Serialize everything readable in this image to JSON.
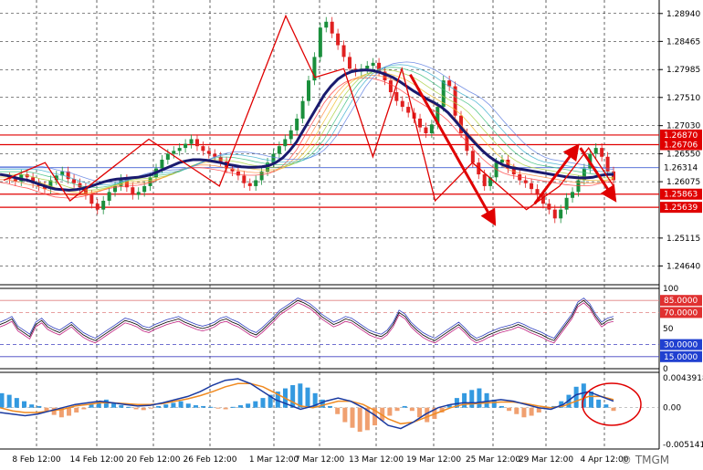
{
  "chart_data": {
    "type": "line",
    "symbol_hint": "",
    "main_panel": {
      "price_ticks": [
        "1.28940",
        "1.28465",
        "1.27985",
        "1.27510",
        "1.27030",
        "1.26550",
        "1.26075",
        "1.25115",
        "1.24640"
      ],
      "price_range": [
        1.2432,
        1.2917
      ],
      "levels": [
        {
          "label": "1.26870",
          "value": 1.2687,
          "color": "#e00000"
        },
        {
          "label": "1.26706",
          "value": 1.26706,
          "color": "#e00000"
        },
        {
          "label": "1.26314",
          "value": 1.26314,
          "color": "#2244cc"
        },
        {
          "label": "1.25863",
          "value": 1.25863,
          "color": "#e00000"
        },
        {
          "label": "1.25639",
          "value": 1.25639,
          "color": "#e00000"
        }
      ],
      "price_series": [
        1.2615,
        1.2612,
        1.2608,
        1.262,
        1.2615,
        1.2605,
        1.26,
        1.2595,
        1.261,
        1.2618,
        1.2625,
        1.2612,
        1.2605,
        1.2598,
        1.2585,
        1.257,
        1.256,
        1.2575,
        1.259,
        1.26,
        1.2612,
        1.2598,
        1.2585,
        1.259,
        1.26,
        1.2615,
        1.263,
        1.2645,
        1.2655,
        1.266,
        1.2665,
        1.2672,
        1.268,
        1.2668,
        1.266,
        1.2655,
        1.265,
        1.2642,
        1.263,
        1.2625,
        1.2618,
        1.2605,
        1.26,
        1.261,
        1.2625,
        1.264,
        1.2655,
        1.2668,
        1.268,
        1.2695,
        1.2715,
        1.2745,
        1.278,
        1.282,
        1.287,
        1.288,
        1.286,
        1.284,
        1.282,
        1.28,
        1.2795,
        1.28,
        1.2805,
        1.281,
        1.2795,
        1.278,
        1.276,
        1.2745,
        1.2735,
        1.2725,
        1.2715,
        1.27,
        1.269,
        1.2705,
        1.2735,
        1.278,
        1.277,
        1.272,
        1.269,
        1.266,
        1.264,
        1.262,
        1.26,
        1.2615,
        1.264,
        1.2645,
        1.263,
        1.262,
        1.261,
        1.2605,
        1.2595,
        1.2585,
        1.257,
        1.256,
        1.2545,
        1.256,
        1.258,
        1.259,
        1.261,
        1.263,
        1.2655,
        1.2665,
        1.265,
        1.2625,
        1.261
      ],
      "ma_series": [
        1.262,
        1.2618,
        1.2615,
        1.2612,
        1.261,
        1.2606,
        1.2602,
        1.2598,
        1.2595,
        1.2594,
        1.2593,
        1.2594,
        1.2596,
        1.2599,
        1.2603,
        1.2607,
        1.261,
        1.2612,
        1.2613,
        1.2614,
        1.2615,
        1.2617,
        1.262,
        1.2625,
        1.263,
        1.2635,
        1.264,
        1.2643,
        1.2645,
        1.2645,
        1.2644,
        1.2642,
        1.264,
        1.2637,
        1.2635,
        1.2633,
        1.2632,
        1.2632,
        1.2633,
        1.2635,
        1.264,
        1.2648,
        1.266,
        1.2675,
        1.2695,
        1.2715,
        1.2735,
        1.2755,
        1.277,
        1.2782,
        1.279,
        1.2795,
        1.2797,
        1.2798,
        1.2797,
        1.2794,
        1.279,
        1.2785,
        1.2778,
        1.277,
        1.2762,
        1.2755,
        1.2748,
        1.2742,
        1.2735,
        1.2725,
        1.2712,
        1.2698,
        1.2685,
        1.2672,
        1.266,
        1.265,
        1.2642,
        1.2636,
        1.2632,
        1.263,
        1.2628,
        1.2626,
        1.2624,
        1.2622,
        1.262,
        1.2618,
        1.2616,
        1.2615,
        1.2614,
        1.2614,
        1.2615,
        1.2618,
        1.262,
        1.262
      ],
      "zigzag": [
        [
          0,
          1.261
        ],
        [
          10,
          1.264
        ],
        [
          16,
          1.2575
        ],
        [
          35,
          1.268
        ],
        [
          52,
          1.26
        ],
        [
          68,
          1.289
        ],
        [
          75,
          1.2785
        ],
        [
          82,
          1.28
        ],
        [
          89,
          1.265
        ],
        [
          96,
          1.28
        ],
        [
          104,
          1.2575
        ],
        [
          113,
          1.264
        ],
        [
          126,
          1.256
        ],
        [
          134,
          1.26
        ],
        [
          141,
          1.2665
        ],
        [
          147,
          1.26
        ]
      ],
      "arrows": [
        {
          "from": [
            98,
            1.279
          ],
          "to": [
            118,
            1.254
          ]
        },
        {
          "from": [
            128,
            1.257
          ],
          "to": [
            138,
            1.2665
          ]
        },
        {
          "from": [
            139,
            1.2665
          ],
          "to": [
            147,
            1.258
          ]
        }
      ]
    },
    "rsi_panel": {
      "ticks": [
        "100",
        "85.0000",
        "70.0000",
        "50",
        "30.0000",
        "15.0000",
        "0"
      ],
      "levels": [
        85,
        70,
        30,
        15
      ],
      "level_labels": [
        "85.0000",
        "70.0000",
        "30.0000",
        "15.0000"
      ],
      "series": [
        55,
        58,
        62,
        50,
        45,
        40,
        55,
        60,
        52,
        48,
        45,
        50,
        55,
        48,
        42,
        38,
        35,
        40,
        45,
        50,
        55,
        60,
        58,
        55,
        50,
        48,
        52,
        55,
        58,
        60,
        62,
        58,
        55,
        52,
        50,
        52,
        55,
        60,
        62,
        58,
        55,
        50,
        45,
        42,
        48,
        55,
        62,
        70,
        75,
        80,
        85,
        82,
        78,
        72,
        65,
        60,
        55,
        58,
        62,
        60,
        55,
        50,
        45,
        42,
        40,
        45,
        55,
        70,
        65,
        55,
        48,
        42,
        38,
        35,
        40,
        45,
        50,
        55,
        48,
        40,
        35,
        38,
        42,
        45,
        48,
        50,
        52,
        55,
        52,
        48,
        45,
        42,
        38,
        35,
        45,
        55,
        65,
        80,
        85,
        78,
        65,
        55,
        60,
        62
      ]
    },
    "macd_panel": {
      "ticks": [
        "0.0043918",
        "0.00",
        "-0.0051412"
      ],
      "range": [
        -0.0051412,
        0.0043918
      ],
      "histogram": [
        0.0018,
        0.0016,
        0.0012,
        0.0008,
        0.0004,
        0.0002,
        -0.0004,
        -0.0009,
        -0.0012,
        -0.001,
        -0.0006,
        -0.0002,
        0.0004,
        0.0008,
        0.001,
        0.0006,
        0.0003,
        0.0001,
        -0.0002,
        -0.0003,
        -0.0001,
        0.0002,
        0.0004,
        0.0006,
        0.0008,
        0.0005,
        0.0003,
        0.0002,
        0.0001,
        -0.0001,
        -0.0002,
        0.0001,
        0.0003,
        0.0005,
        0.0008,
        0.0012,
        0.0016,
        0.002,
        0.0024,
        0.0028,
        0.003,
        0.0025,
        0.0018,
        0.001,
        0.0002,
        -0.0008,
        -0.0018,
        -0.0025,
        -0.003,
        -0.0028,
        -0.0022,
        -0.0016,
        -0.001,
        -0.0004,
        0.0002,
        -0.0004,
        -0.0012,
        -0.0018,
        -0.0014,
        -0.0006,
        0.0004,
        0.0012,
        0.0018,
        0.0022,
        0.0024,
        0.0018,
        0.001,
        0.0002,
        -0.0004,
        -0.0008,
        -0.0012,
        -0.001,
        -0.0006,
        -0.0002,
        0.0002,
        0.0008,
        0.0016,
        0.0026,
        0.003,
        0.002,
        0.001,
        0.0004,
        -0.0004
      ],
      "macd_line": [
        -0.0006,
        -0.0008,
        -0.001,
        -0.0008,
        -0.0004,
        0.0,
        0.0004,
        0.0006,
        0.0008,
        0.0006,
        0.0004,
        0.0002,
        0.0003,
        0.0006,
        0.001,
        0.0014,
        0.002,
        0.0028,
        0.0034,
        0.0036,
        0.003,
        0.002,
        0.001,
        0.0004,
        -0.0002,
        0.0002,
        0.0008,
        0.0012,
        0.0008,
        0.0,
        -0.001,
        -0.0022,
        -0.0026,
        -0.0018,
        -0.0008,
        0.0,
        0.0004,
        0.0006,
        0.0006,
        0.0008,
        0.001,
        0.0008,
        0.0004,
        0.0,
        -0.0002,
        0.0004,
        0.0016,
        0.002,
        0.0014,
        0.0008
      ],
      "signal_line": [
        0.0,
        -0.0004,
        -0.0006,
        -0.0006,
        -0.0004,
        -0.0002,
        0.0002,
        0.0004,
        0.0006,
        0.0006,
        0.0005,
        0.0004,
        0.0004,
        0.0005,
        0.0008,
        0.0011,
        0.0015,
        0.002,
        0.0026,
        0.003,
        0.003,
        0.0026,
        0.0018,
        0.001,
        0.0002,
        0.0,
        0.0004,
        0.0008,
        0.0008,
        0.0004,
        -0.0004,
        -0.0014,
        -0.002,
        -0.0018,
        -0.0012,
        -0.0006,
        0.0,
        0.0004,
        0.0005,
        0.0006,
        0.0007,
        0.0007,
        0.0005,
        0.0002,
        0.0,
        0.0002,
        0.0008,
        0.0014,
        0.0014,
        0.001
      ]
    },
    "dates": [
      "8 Feb 12:00",
      "14 Feb 12:00",
      "20 Feb 12:00",
      "26 Feb 12:00",
      "1 Mar 12:00",
      "7 Mar 12:00",
      "13 Mar 12:00",
      "19 Mar 12:00",
      "25 Mar 12:00",
      "29 Mar 12:00",
      "4 Apr 12:00"
    ]
  },
  "watermark": "TMGM",
  "colors": {
    "bull": "#1a8f3c",
    "bear": "#e02020",
    "ma": "#1a1a6e",
    "zigzag": "#e00000",
    "hist_pos": "#3399e0",
    "hist_neg": "#f0a070",
    "macd": "#1a3aa0",
    "signal": "#f08a20"
  }
}
